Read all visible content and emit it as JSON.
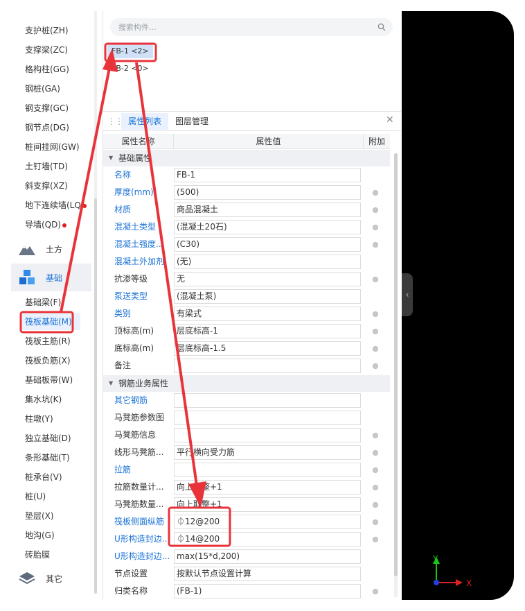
{
  "sidebar": {
    "items_top": [
      {
        "label": "支护桩(ZH)"
      },
      {
        "label": "支撑梁(ZC)"
      },
      {
        "label": "格构柱(GG)"
      },
      {
        "label": "钢桩(GA)"
      },
      {
        "label": "钢支撑(GC)"
      },
      {
        "label": "钢节点(DG)"
      },
      {
        "label": "桩间挂网(GW)"
      },
      {
        "label": "土钉墙(TD)"
      },
      {
        "label": "斜支撑(XZ)"
      },
      {
        "label": "地下连续墙(LQ"
      },
      {
        "label": "导墙(QD)"
      }
    ],
    "categories": {
      "earth": "土方",
      "foundation": "基础",
      "other": "其它"
    },
    "items_foundation": [
      {
        "label": "基础梁(F)"
      },
      {
        "label": "筏板基础(M)"
      },
      {
        "label": "筏板主筋(R)"
      },
      {
        "label": "筏板负筋(X)"
      },
      {
        "label": "基础板带(W)"
      },
      {
        "label": "集水坑(K)"
      },
      {
        "label": "柱墩(Y)"
      },
      {
        "label": "独立基础(D)"
      },
      {
        "label": "条形基础(T)"
      },
      {
        "label": "桩承台(V)"
      },
      {
        "label": "桩(U)"
      },
      {
        "label": "垫层(X)"
      },
      {
        "label": "地沟(G)"
      },
      {
        "label": "砖胎膜"
      }
    ]
  },
  "search": {
    "placeholder": "搜索构件..."
  },
  "components": [
    "FB-1 <2>",
    "FB-2 <0>"
  ],
  "tabs": {
    "active": "属性列表",
    "other": "图层管理"
  },
  "grid": {
    "headers": {
      "name": "属性名称",
      "value": "属性值",
      "add": "附加"
    },
    "group1": "基础属性",
    "group2": "钢筋业务属性",
    "rows1": [
      {
        "name": "名称",
        "value": "FB-1"
      },
      {
        "name": "厚度(mm)",
        "value": "(500)"
      },
      {
        "name": "材质",
        "value": "商品混凝土"
      },
      {
        "name": "混凝土类型",
        "value": "(混凝土20石)"
      },
      {
        "name": "混凝土强度...",
        "value": "(C30)"
      },
      {
        "name": "混凝土外加剂",
        "value": "(无)"
      },
      {
        "name": "抗渗等级",
        "value": "无"
      },
      {
        "name": "泵送类型",
        "value": "(混凝土泵)"
      },
      {
        "name": "类别",
        "value": "有梁式"
      },
      {
        "name": "顶标高(m)",
        "value": "层底标高-1"
      },
      {
        "name": "底标高(m)",
        "value": "层底标高-1.5"
      },
      {
        "name": "备注",
        "value": ""
      }
    ],
    "rows2": [
      {
        "name": "其它钢筋",
        "value": ""
      },
      {
        "name": "马凳筋参数图",
        "value": ""
      },
      {
        "name": "马凳筋信息",
        "value": ""
      },
      {
        "name": "线形马凳筋...",
        "value": "平行横向受力筋"
      },
      {
        "name": "拉筋",
        "value": ""
      },
      {
        "name": "拉筋数量计...",
        "value": "向上取整+1"
      },
      {
        "name": "马凳筋数量...",
        "value": "向上取整+1"
      },
      {
        "name": "筏板侧面纵筋",
        "value": "⏀12@200"
      },
      {
        "name": "U形构造封边...",
        "value": "⏀14@200"
      },
      {
        "name": "U形构造封边...",
        "value": "max(15*d,200)"
      },
      {
        "name": "节点设置",
        "value": "按默认节点设置计算"
      },
      {
        "name": "归类名称",
        "value": "(FB-1)"
      }
    ]
  },
  "axes": {
    "x": "X",
    "y": "Y"
  },
  "colors": {
    "accent": "#1a72d6",
    "highlight_red": "#e8333a",
    "canvas": "#000000"
  }
}
